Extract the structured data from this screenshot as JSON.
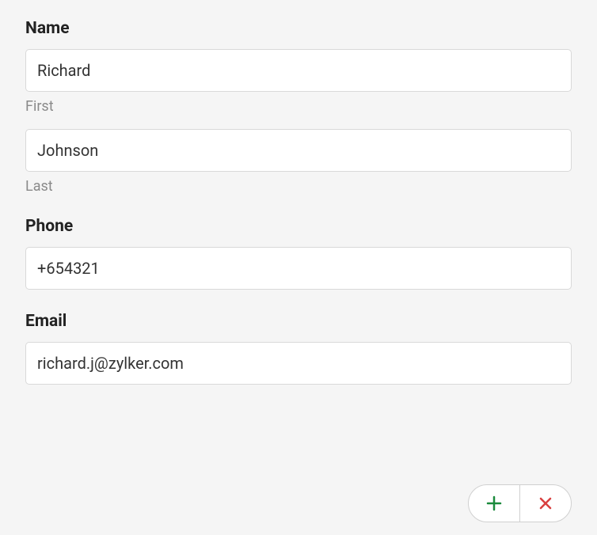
{
  "form": {
    "name": {
      "label": "Name",
      "first_value": "Richard",
      "first_sublabel": "First",
      "last_value": "Johnson",
      "last_sublabel": "Last"
    },
    "phone": {
      "label": "Phone",
      "value": "+654321"
    },
    "email": {
      "label": "Email",
      "value": "richard.j@zylker.com"
    }
  },
  "actions": {
    "add_icon": "plus-icon",
    "cancel_icon": "close-icon"
  },
  "colors": {
    "add": "#1a8a3c",
    "cancel": "#d93f3f"
  }
}
